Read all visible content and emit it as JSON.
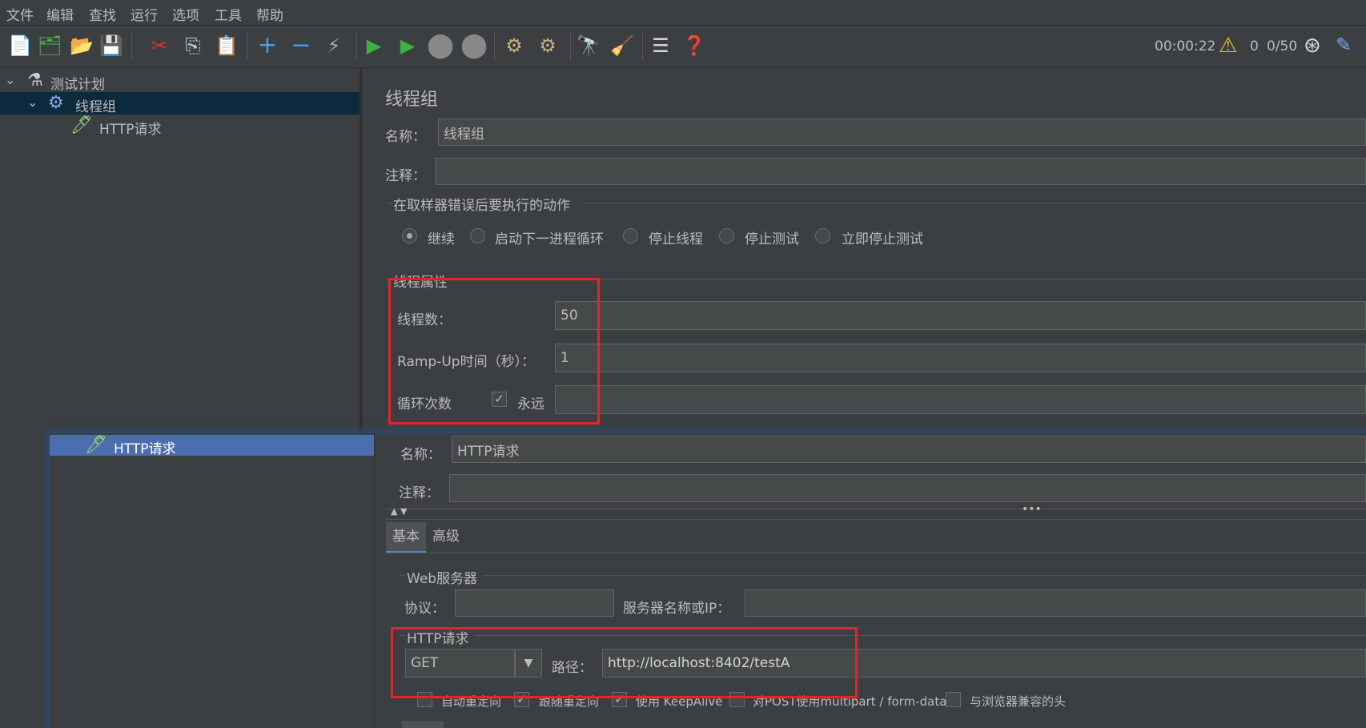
{
  "menu": [
    "文件",
    "编辑",
    "查找",
    "运行",
    "选项",
    "工具",
    "帮助"
  ],
  "toolbar": {
    "timer": "00:00:22",
    "warning_count": "0",
    "threads": "0/50"
  },
  "tree": {
    "root": "测试计划",
    "thread_group": "线程组",
    "http_request": "HTTP请求"
  },
  "thread_group_panel": {
    "title": "线程组",
    "name_label": "名称：",
    "name_value": "线程组",
    "comment_label": "注释：",
    "comment_value": "",
    "error_action_legend": "在取样器错误后要执行的动作",
    "error_actions": [
      "继续",
      "启动下一进程循环",
      "停止线程",
      "停止测试",
      "立即停止测试"
    ],
    "selected_error_action": "继续",
    "props_legend": "线程属性",
    "threads_label": "线程数：",
    "threads_value": "50",
    "rampup_label": "Ramp-Up时间（秒）：",
    "rampup_value": "1",
    "loop_label": "循环次数",
    "forever_label": "永远",
    "forever_checked": true,
    "loop_value": ""
  },
  "http_overlay": {
    "tree_item": "HTTP请求",
    "name_label": "名称：",
    "name_value": "HTTP请求",
    "comment_label": "注释：",
    "comment_value": "",
    "tabs": [
      "基本",
      "高级"
    ],
    "web_server_legend": "Web服务器",
    "protocol_label": "协议：",
    "protocol_value": "",
    "server_label": "服务器名称或IP：",
    "server_value": "",
    "http_legend": "HTTP请求",
    "method": "GET",
    "path_label": "路径：",
    "path_value": "http://localhost:8402/testA",
    "options": [
      {
        "label": "自动重定向",
        "checked": false
      },
      {
        "label": "跟随重定向",
        "checked": true
      },
      {
        "label": "使用 KeepAlive",
        "checked": true
      },
      {
        "label": "对POST使用multipart / form-data",
        "checked": false
      },
      {
        "label": "与浏览器兼容的头",
        "checked": false
      }
    ]
  },
  "colors": {
    "background": "#3c3f41",
    "field": "#45494a",
    "selection": "#0d293e",
    "overlay_selection": "#4b6eaf",
    "highlight_box": "#e0262a"
  }
}
